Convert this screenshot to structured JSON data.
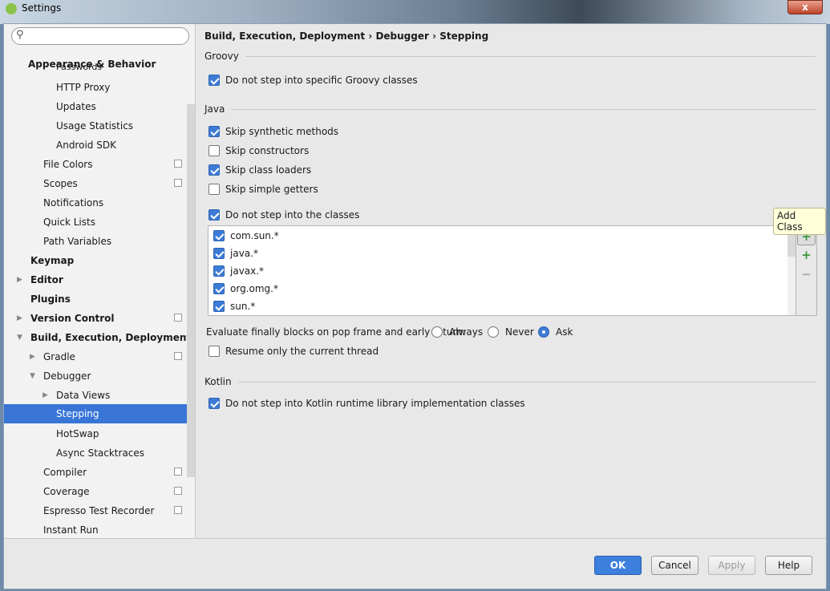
{
  "window": {
    "title": "Settings",
    "close": "x"
  },
  "sidebar": {
    "search_placeholder": "",
    "items": [
      {
        "label": "Appearance & Behavior",
        "bold": true
      },
      {
        "label": "Passwords"
      },
      {
        "label": "HTTP Proxy"
      },
      {
        "label": "Updates"
      },
      {
        "label": "Usage Statistics"
      },
      {
        "label": "Android SDK"
      },
      {
        "label": "File Colors"
      },
      {
        "label": "Scopes"
      },
      {
        "label": "Notifications"
      },
      {
        "label": "Quick Lists"
      },
      {
        "label": "Path Variables"
      },
      {
        "label": "Keymap"
      },
      {
        "label": "Editor"
      },
      {
        "label": "Plugins"
      },
      {
        "label": "Version Control"
      },
      {
        "label": "Build, Execution, Deployment"
      },
      {
        "label": "Gradle"
      },
      {
        "label": "Debugger"
      },
      {
        "label": "Data Views"
      },
      {
        "label": "Stepping"
      },
      {
        "label": "HotSwap"
      },
      {
        "label": "Async Stacktraces"
      },
      {
        "label": "Compiler"
      },
      {
        "label": "Coverage"
      },
      {
        "label": "Espresso Test Recorder"
      },
      {
        "label": "Instant Run"
      }
    ]
  },
  "breadcrumb": "Build, Execution, Deployment › Debugger › Stepping",
  "groovy": {
    "title": "Groovy",
    "no_step_groovy": {
      "label": "Do not step into specific Groovy classes",
      "checked": true
    }
  },
  "java": {
    "title": "Java",
    "skip_synthetic": {
      "label": "Skip synthetic methods",
      "checked": true
    },
    "skip_constructors": {
      "label": "Skip constructors",
      "checked": false
    },
    "skip_class_loaders": {
      "label": "Skip class loaders",
      "checked": true
    },
    "skip_getters": {
      "label": "Skip simple getters",
      "checked": false
    },
    "no_step_classes": {
      "label": "Do not step into the classes",
      "checked": true
    },
    "classes": [
      "com.sun.*",
      "java.*",
      "javax.*",
      "org.omg.*",
      "sun.*"
    ],
    "tooltip": "Add Class",
    "finally_label": "Evaluate finally blocks on pop frame and early return:",
    "finally_options": [
      "Always",
      "Never",
      "Ask"
    ],
    "finally_selected": "Ask",
    "resume_current": {
      "label": "Resume only the current thread",
      "checked": false
    }
  },
  "kotlin": {
    "title": "Kotlin",
    "no_step_kotlin": {
      "label": "Do not step into Kotlin runtime library implementation classes",
      "checked": true
    }
  },
  "buttons": {
    "ok": "OK",
    "cancel": "Cancel",
    "apply": "Apply",
    "help": "Help"
  }
}
